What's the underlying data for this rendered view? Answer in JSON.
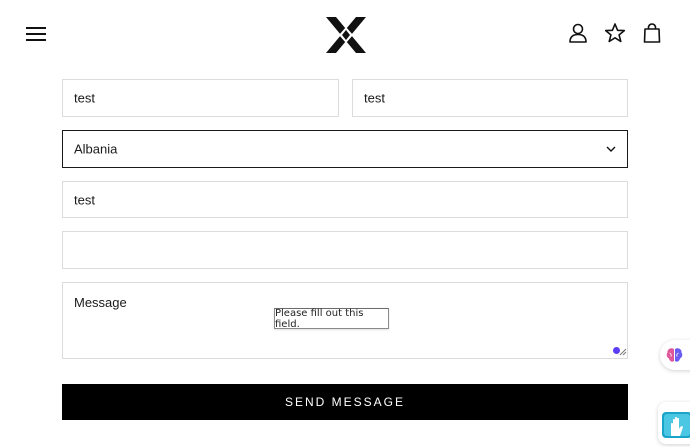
{
  "header": {
    "menu_icon": "hamburger-menu-icon",
    "logo_icon": "brand-x-logo",
    "account_icon": "user-icon",
    "wishlist_icon": "star-icon",
    "cart_icon": "shopping-bag-icon"
  },
  "form": {
    "first_name_value": "test",
    "last_name_value": "test",
    "country_value": "Albania",
    "field_three_value": "test",
    "field_four_value": "",
    "message_placeholder": "Message",
    "validation_tooltip": "Please fill out this field.",
    "submit_label": "SEND MESSAGE"
  },
  "extensions": {
    "brain_icon": "brain-extension-icon",
    "hand_icon": "hand-extension-icon"
  },
  "colors": {
    "button_bg": "#000000",
    "button_text": "#ffffff",
    "field_border": "#dcdcdc",
    "focus_border": "#1a1a1a",
    "grammar_dot": "#5b3df5"
  }
}
